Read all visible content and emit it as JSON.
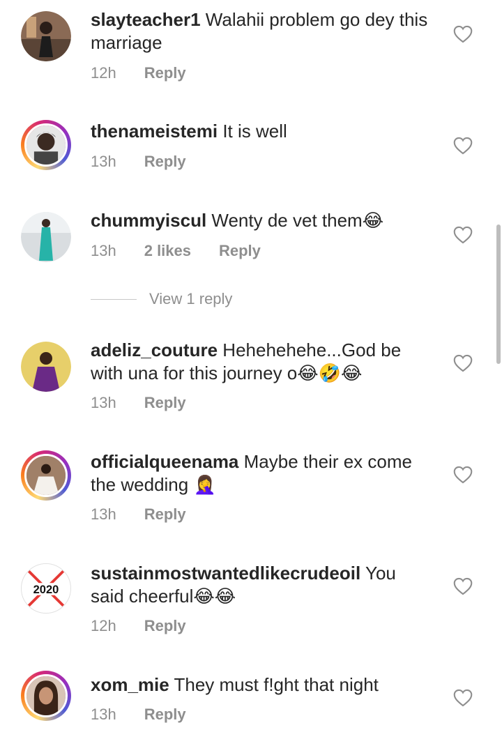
{
  "comments": [
    {
      "username": "slayteacher1",
      "text": "Walahii problem go dey this marriage",
      "time": "12h",
      "likes": "",
      "reply_label": "Reply",
      "story": false,
      "avatar_icon": "person-photo"
    },
    {
      "username": "thenameistemi",
      "text": "It is well",
      "time": "13h",
      "likes": "",
      "reply_label": "Reply",
      "story": true,
      "avatar_icon": "person-photo"
    },
    {
      "username": "chummyiscul",
      "text": "Wenty de vet them😂",
      "time": "13h",
      "likes": "2 likes",
      "reply_label": "Reply",
      "story": false,
      "avatar_icon": "person-photo"
    },
    {
      "username": "adeliz_couture",
      "text": "Hehehehehe...God be with una for this journey o😂🤣😂",
      "time": "13h",
      "likes": "",
      "reply_label": "Reply",
      "story": false,
      "avatar_icon": "person-photo"
    },
    {
      "username": "officialqueenama",
      "text": "Maybe their ex come the wedding 🤦‍♀️",
      "time": "13h",
      "likes": "",
      "reply_label": "Reply",
      "story": true,
      "avatar_icon": "person-photo"
    },
    {
      "username": "sustainmostwantedlikecrudeoil",
      "text": "You said cheerful😂😂",
      "time": "12h",
      "likes": "",
      "reply_label": "Reply",
      "story": false,
      "avatar_icon": "crossed-2020-logo"
    },
    {
      "username": "xom_mie",
      "text": "They must f!ght that night",
      "time": "13h",
      "likes": "",
      "reply_label": "Reply",
      "story": true,
      "avatar_icon": "person-photo"
    }
  ],
  "view_replies_label": "View 1 reply",
  "avatar_2020_text": "2020",
  "colors": {
    "meta": "#8e8e8e",
    "text": "#262626"
  }
}
